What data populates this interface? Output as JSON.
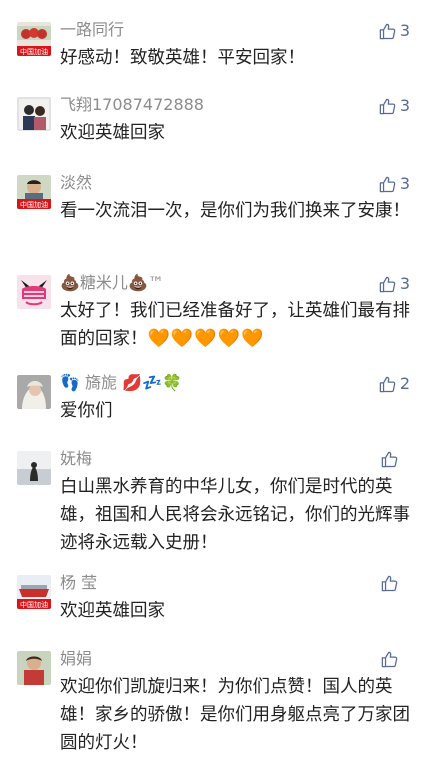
{
  "comments": [
    {
      "name": "一路同行",
      "text": "好感动！致敬英雄！平安回家！",
      "likes": "3",
      "avatar_label": "中国加油"
    },
    {
      "name": "飞翔17087472888",
      "text": "欢迎英雄回家",
      "likes": "3"
    },
    {
      "name": "淡然",
      "text": "看一次流泪一次，是你们为我们换来了安康！",
      "likes": "3",
      "avatar_label": "中国加油"
    },
    {
      "name_prefix": "💩",
      "name": "糖米儿",
      "name_suffix": "💩™",
      "text": "太好了！我们已经准备好了，让英雄们最有排面的回家！",
      "text_suffix": "🧡🧡🧡🧡🧡",
      "likes": "3"
    },
    {
      "name_prefix": "👣",
      "name": "旖旎",
      "name_suffix": "💋💤🍀",
      "text": "爱你们",
      "likes": "2"
    },
    {
      "name": "妩梅",
      "text": "白山黑水养育的中华儿女，你们是时代的英雄，祖国和人民将会永远铭记，你们的光辉事迹将永远载入史册！",
      "likes": ""
    },
    {
      "name": "杨 莹",
      "text": "欢迎英雄回家",
      "likes": "",
      "avatar_label": "中国加油"
    },
    {
      "name": "娟娟",
      "text": "欢迎你们凯旋归来！为你们点赞！国人的英雄！家乡的骄傲！是你们用身躯点亮了万家团圆的灯火！",
      "likes": ""
    }
  ],
  "colors": {
    "link": "#576b95",
    "name": "#8c8c8c",
    "text": "#222222",
    "heart": "#f37321",
    "flag_red": "#d7161b"
  },
  "icons": {
    "like": "thumbs-up-icon"
  }
}
